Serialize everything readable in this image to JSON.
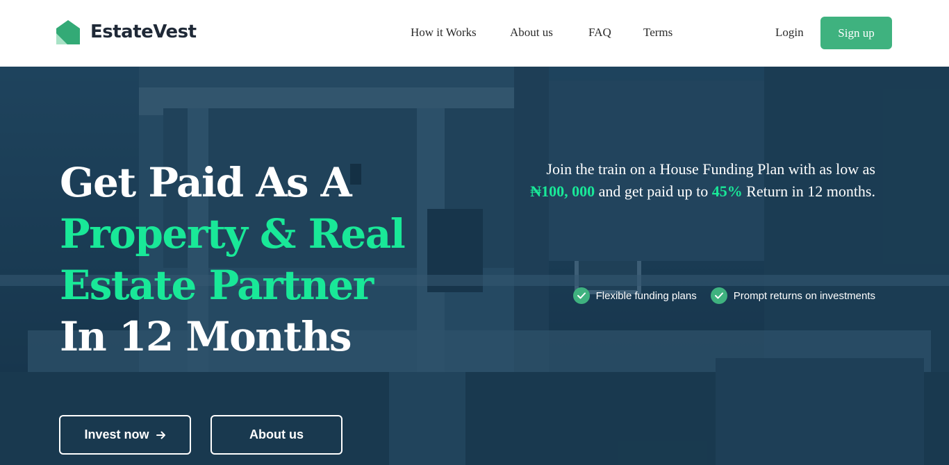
{
  "brand": {
    "name": "EstateVest",
    "accent": "#3fb27f",
    "highlight": "#19e898"
  },
  "nav": {
    "items": [
      "How it Works",
      "About us",
      "FAQ",
      "Terms"
    ],
    "login": "Login",
    "signup": "Sign up"
  },
  "hero": {
    "headline": {
      "line1": "Get Paid As A",
      "line2": "Property & Real",
      "line3": "Estate Partner",
      "line4": "In 12 Months"
    },
    "intro": {
      "part1": "Join the train on a House Funding Plan with as low as",
      "amount": "₦100, 000",
      "part2": "and get paid up to",
      "rate": "45%",
      "part3": "Return in 12 months."
    },
    "features": [
      "Flexible funding plans",
      "Prompt returns on investments"
    ],
    "buttons": {
      "invest": "Invest now",
      "about": "About us"
    },
    "icons": {
      "feature": "check-icon",
      "invest": "arrow-right-icon",
      "logo": "house-icon"
    }
  }
}
